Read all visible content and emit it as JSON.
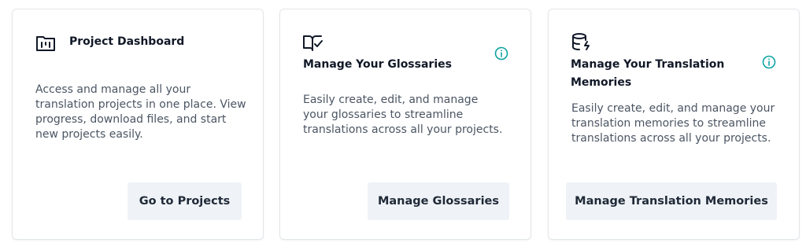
{
  "cards": [
    {
      "icon": "project-board-icon",
      "title": "Project Dashboard",
      "description": "Access and manage all your translation projects in one place. View progress, download files, and start new projects easily.",
      "button_label": "Go to Projects"
    },
    {
      "icon": "glossary-book-icon",
      "info_icon": "info-icon",
      "title": "Manage Your Glossaries",
      "description": "Easily create, edit, and manage your glossaries to streamline translations across all your projects.",
      "button_label": "Manage Glossaries"
    },
    {
      "icon": "database-flash-icon",
      "info_icon": "info-icon",
      "title": "Manage Your Translation Memories",
      "description": "Easily create, edit, and manage your translation memories to streamline translations across all your projects.",
      "button_label": "Manage Translation Memories"
    }
  ],
  "colors": {
    "info_accent": "#0fa3a3",
    "button_bg": "#eff3f7",
    "card_border": "#e3e6ea"
  }
}
